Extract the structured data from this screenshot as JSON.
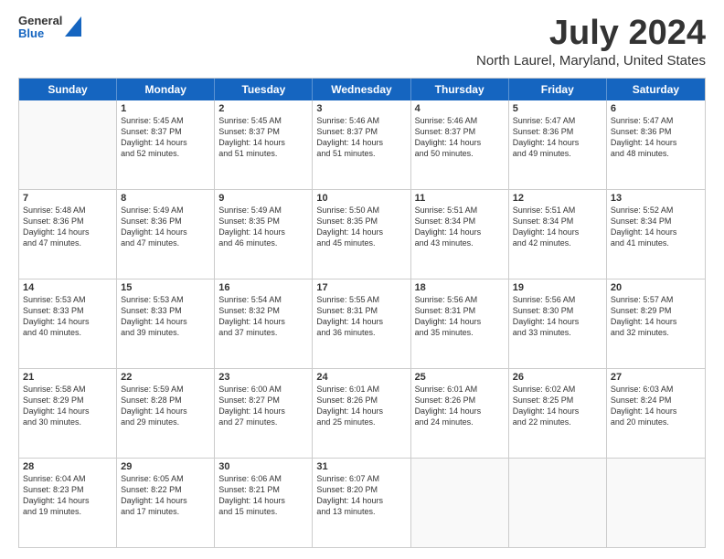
{
  "logo": {
    "general": "General",
    "blue": "Blue"
  },
  "title": "July 2024",
  "subtitle": "North Laurel, Maryland, United States",
  "header_days": [
    "Sunday",
    "Monday",
    "Tuesday",
    "Wednesday",
    "Thursday",
    "Friday",
    "Saturday"
  ],
  "weeks": [
    [
      {
        "day": "",
        "info": ""
      },
      {
        "day": "1",
        "info": "Sunrise: 5:45 AM\nSunset: 8:37 PM\nDaylight: 14 hours\nand 52 minutes."
      },
      {
        "day": "2",
        "info": "Sunrise: 5:45 AM\nSunset: 8:37 PM\nDaylight: 14 hours\nand 51 minutes."
      },
      {
        "day": "3",
        "info": "Sunrise: 5:46 AM\nSunset: 8:37 PM\nDaylight: 14 hours\nand 51 minutes."
      },
      {
        "day": "4",
        "info": "Sunrise: 5:46 AM\nSunset: 8:37 PM\nDaylight: 14 hours\nand 50 minutes."
      },
      {
        "day": "5",
        "info": "Sunrise: 5:47 AM\nSunset: 8:36 PM\nDaylight: 14 hours\nand 49 minutes."
      },
      {
        "day": "6",
        "info": "Sunrise: 5:47 AM\nSunset: 8:36 PM\nDaylight: 14 hours\nand 48 minutes."
      }
    ],
    [
      {
        "day": "7",
        "info": "Sunrise: 5:48 AM\nSunset: 8:36 PM\nDaylight: 14 hours\nand 47 minutes."
      },
      {
        "day": "8",
        "info": "Sunrise: 5:49 AM\nSunset: 8:36 PM\nDaylight: 14 hours\nand 47 minutes."
      },
      {
        "day": "9",
        "info": "Sunrise: 5:49 AM\nSunset: 8:35 PM\nDaylight: 14 hours\nand 46 minutes."
      },
      {
        "day": "10",
        "info": "Sunrise: 5:50 AM\nSunset: 8:35 PM\nDaylight: 14 hours\nand 45 minutes."
      },
      {
        "day": "11",
        "info": "Sunrise: 5:51 AM\nSunset: 8:34 PM\nDaylight: 14 hours\nand 43 minutes."
      },
      {
        "day": "12",
        "info": "Sunrise: 5:51 AM\nSunset: 8:34 PM\nDaylight: 14 hours\nand 42 minutes."
      },
      {
        "day": "13",
        "info": "Sunrise: 5:52 AM\nSunset: 8:34 PM\nDaylight: 14 hours\nand 41 minutes."
      }
    ],
    [
      {
        "day": "14",
        "info": "Sunrise: 5:53 AM\nSunset: 8:33 PM\nDaylight: 14 hours\nand 40 minutes."
      },
      {
        "day": "15",
        "info": "Sunrise: 5:53 AM\nSunset: 8:33 PM\nDaylight: 14 hours\nand 39 minutes."
      },
      {
        "day": "16",
        "info": "Sunrise: 5:54 AM\nSunset: 8:32 PM\nDaylight: 14 hours\nand 37 minutes."
      },
      {
        "day": "17",
        "info": "Sunrise: 5:55 AM\nSunset: 8:31 PM\nDaylight: 14 hours\nand 36 minutes."
      },
      {
        "day": "18",
        "info": "Sunrise: 5:56 AM\nSunset: 8:31 PM\nDaylight: 14 hours\nand 35 minutes."
      },
      {
        "day": "19",
        "info": "Sunrise: 5:56 AM\nSunset: 8:30 PM\nDaylight: 14 hours\nand 33 minutes."
      },
      {
        "day": "20",
        "info": "Sunrise: 5:57 AM\nSunset: 8:29 PM\nDaylight: 14 hours\nand 32 minutes."
      }
    ],
    [
      {
        "day": "21",
        "info": "Sunrise: 5:58 AM\nSunset: 8:29 PM\nDaylight: 14 hours\nand 30 minutes."
      },
      {
        "day": "22",
        "info": "Sunrise: 5:59 AM\nSunset: 8:28 PM\nDaylight: 14 hours\nand 29 minutes."
      },
      {
        "day": "23",
        "info": "Sunrise: 6:00 AM\nSunset: 8:27 PM\nDaylight: 14 hours\nand 27 minutes."
      },
      {
        "day": "24",
        "info": "Sunrise: 6:01 AM\nSunset: 8:26 PM\nDaylight: 14 hours\nand 25 minutes."
      },
      {
        "day": "25",
        "info": "Sunrise: 6:01 AM\nSunset: 8:26 PM\nDaylight: 14 hours\nand 24 minutes."
      },
      {
        "day": "26",
        "info": "Sunrise: 6:02 AM\nSunset: 8:25 PM\nDaylight: 14 hours\nand 22 minutes."
      },
      {
        "day": "27",
        "info": "Sunrise: 6:03 AM\nSunset: 8:24 PM\nDaylight: 14 hours\nand 20 minutes."
      }
    ],
    [
      {
        "day": "28",
        "info": "Sunrise: 6:04 AM\nSunset: 8:23 PM\nDaylight: 14 hours\nand 19 minutes."
      },
      {
        "day": "29",
        "info": "Sunrise: 6:05 AM\nSunset: 8:22 PM\nDaylight: 14 hours\nand 17 minutes."
      },
      {
        "day": "30",
        "info": "Sunrise: 6:06 AM\nSunset: 8:21 PM\nDaylight: 14 hours\nand 15 minutes."
      },
      {
        "day": "31",
        "info": "Sunrise: 6:07 AM\nSunset: 8:20 PM\nDaylight: 14 hours\nand 13 minutes."
      },
      {
        "day": "",
        "info": ""
      },
      {
        "day": "",
        "info": ""
      },
      {
        "day": "",
        "info": ""
      }
    ]
  ]
}
